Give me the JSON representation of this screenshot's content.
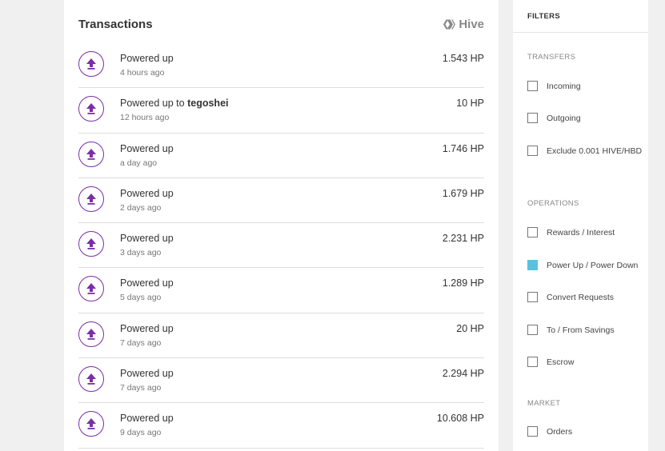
{
  "transactions_panel": {
    "title": "Transactions",
    "brand": "Hive",
    "accent_color": "#7b2ea8",
    "rows": [
      {
        "title": "Powered up",
        "target": "",
        "time": "4 hours ago",
        "amount": "1.543 HP"
      },
      {
        "title": "Powered up to",
        "target": "tegoshei",
        "time": "12 hours ago",
        "amount": "10 HP"
      },
      {
        "title": "Powered up",
        "target": "",
        "time": "a day ago",
        "amount": "1.746 HP"
      },
      {
        "title": "Powered up",
        "target": "",
        "time": "2 days ago",
        "amount": "1.679 HP"
      },
      {
        "title": "Powered up",
        "target": "",
        "time": "3 days ago",
        "amount": "2.231 HP"
      },
      {
        "title": "Powered up",
        "target": "",
        "time": "5 days ago",
        "amount": "1.289 HP"
      },
      {
        "title": "Powered up",
        "target": "",
        "time": "7 days ago",
        "amount": "20 HP"
      },
      {
        "title": "Powered up",
        "target": "",
        "time": "7 days ago",
        "amount": "2.294 HP"
      },
      {
        "title": "Powered up",
        "target": "",
        "time": "9 days ago",
        "amount": "10.608 HP"
      }
    ]
  },
  "filters": {
    "title": "FILTERS",
    "checked_color": "#5bc0de",
    "transfers": {
      "label": "TRANSFERS",
      "items": [
        {
          "label": "Incoming",
          "checked": false
        },
        {
          "label": "Outgoing",
          "checked": false
        },
        {
          "label": "Exclude 0.001 HIVE/HBD",
          "checked": false
        }
      ]
    },
    "operations": {
      "label": "OPERATIONS",
      "items": [
        {
          "label": "Rewards / Interest",
          "checked": false
        },
        {
          "label": "Power Up / Power Down",
          "checked": true
        },
        {
          "label": "Convert Requests",
          "checked": false
        },
        {
          "label": "To / From Savings",
          "checked": false
        },
        {
          "label": "Escrow",
          "checked": false
        }
      ]
    },
    "market": {
      "label": "MARKET",
      "items": [
        {
          "label": "Orders",
          "checked": false
        }
      ]
    }
  }
}
